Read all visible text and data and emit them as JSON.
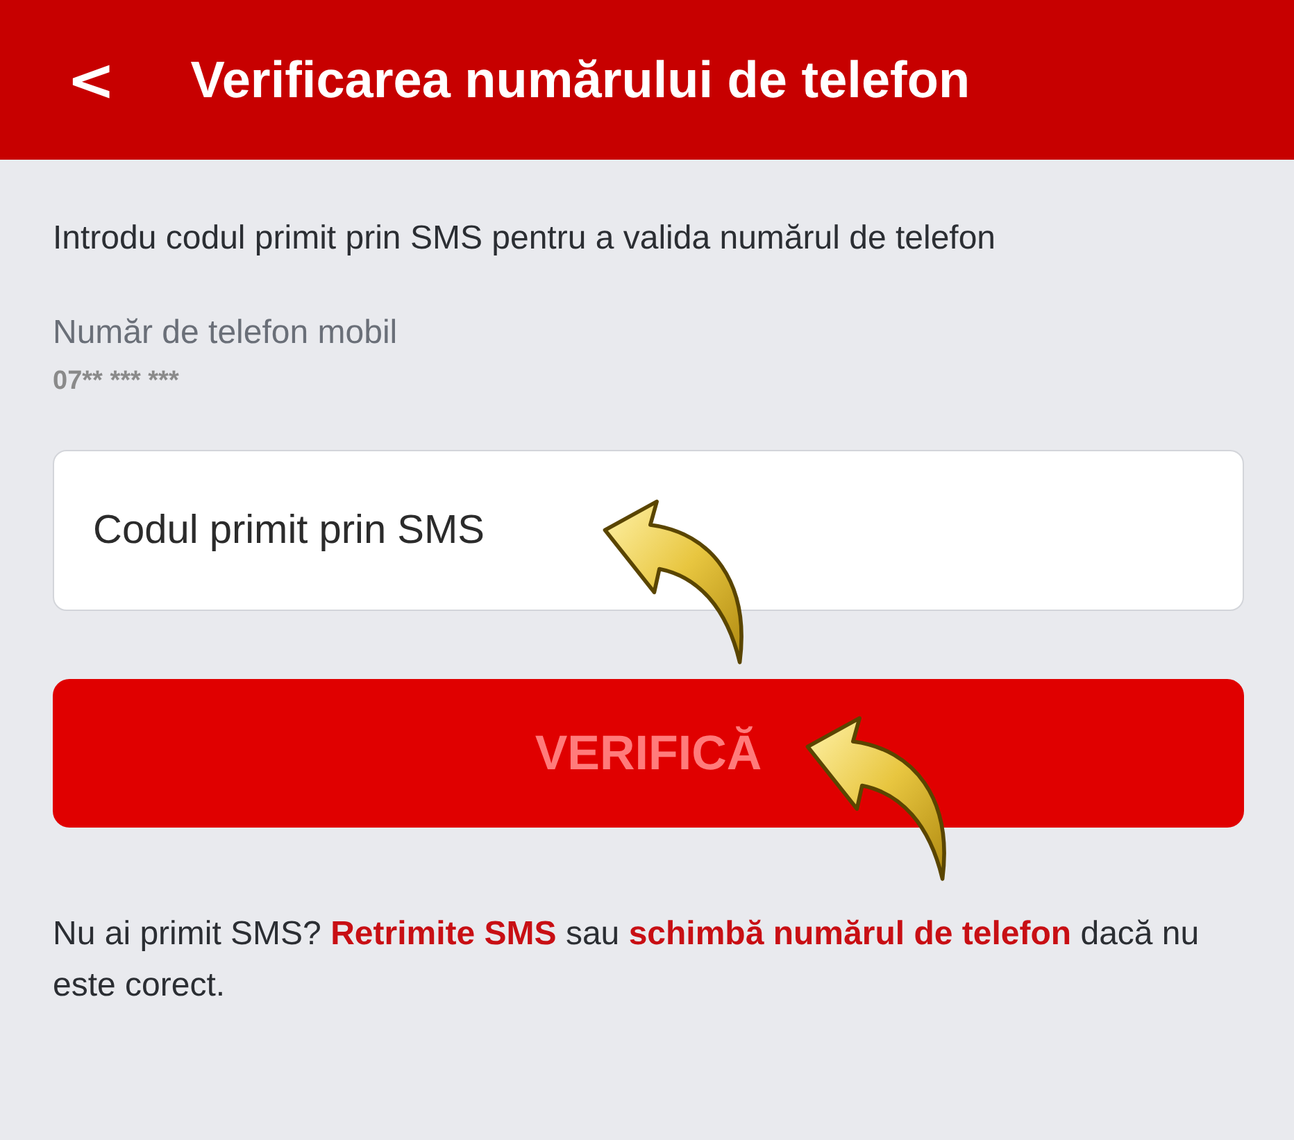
{
  "header": {
    "back_icon": "<",
    "title": "Verificarea numărului de telefon"
  },
  "intro": "Introdu codul primit prin SMS pentru a valida numărul de telefon",
  "phone": {
    "label": "Număr de telefon mobil",
    "value": "07** *** ***"
  },
  "code_field": {
    "placeholder": "Codul primit prin SMS"
  },
  "verify_button": {
    "label": "VERIFICĂ",
    "disabled": true
  },
  "footer": [
    {
      "kind": "text",
      "text": "Nu ai primit SMS?"
    },
    {
      "kind": "link",
      "text": "Retrimite SMS"
    },
    {
      "kind": "text",
      "text": "sau"
    },
    {
      "kind": "link",
      "text": "schimbă numărul de telefon"
    },
    {
      "kind": "text",
      "text": "dacă nu este corect."
    }
  ]
}
